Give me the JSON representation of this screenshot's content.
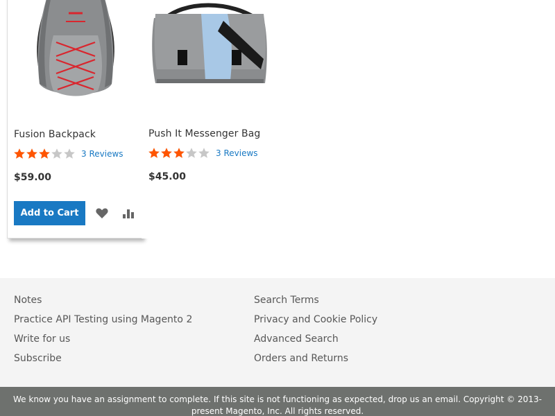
{
  "products": [
    {
      "name": "Fusion Backpack",
      "rating_fraction": 0.6,
      "reviews": "3 Reviews",
      "price": "$59.00",
      "image_icon": "backpack-image"
    },
    {
      "name": "Push It Messenger Bag",
      "rating_fraction": 0.6,
      "reviews": "3 Reviews",
      "price": "$45.00",
      "image_icon": "messenger-bag-image"
    }
  ],
  "actions": {
    "add_to_cart_label": "Add to Cart",
    "wishlist_icon": "heart-icon",
    "compare_icon": "bar-chart-icon"
  },
  "footer": {
    "left_links": [
      "Notes",
      "Practice API Testing using Magento 2",
      "Write for us",
      "Subscribe"
    ],
    "right_links": [
      "Search Terms",
      "Privacy and Cookie Policy",
      "Advanced Search",
      "Orders and Returns"
    ]
  },
  "copyright": {
    "text": "We know you have an assignment to complete. If this site is not functioning as expected, drop us an email. Copyright © 2013-present Magento, Inc. All rights reserved."
  },
  "colors": {
    "accent": "#1979c3",
    "star_filled": "#ff5501",
    "star_empty": "#c7c7c7",
    "footer_bg": "#f4f4f4",
    "copyright_bg": "#6e716e"
  }
}
